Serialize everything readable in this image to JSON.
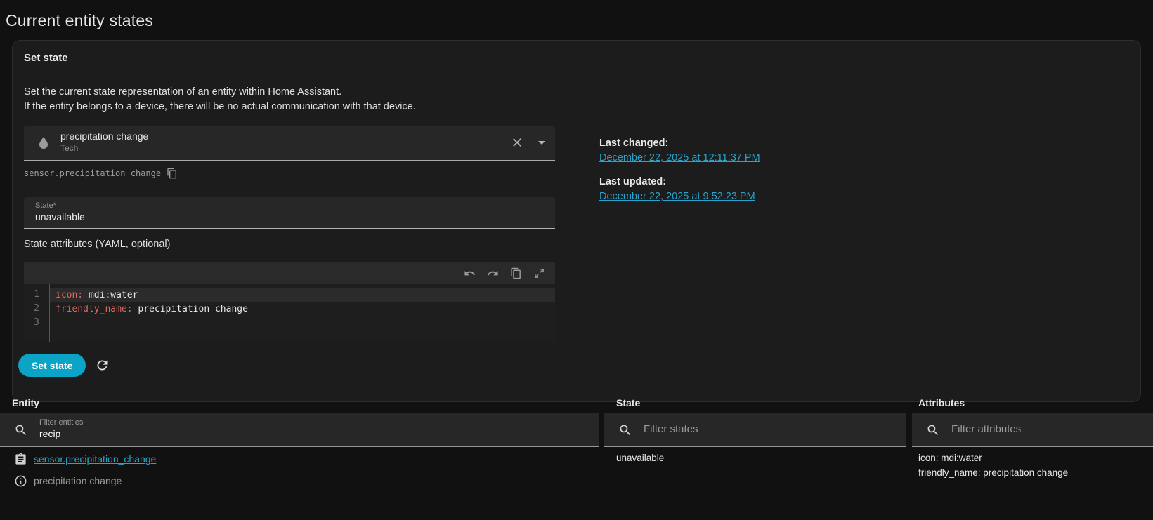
{
  "page": {
    "title": "Current entity states"
  },
  "card": {
    "title": "Set state",
    "description_line1": "Set the current state representation of an entity within Home Assistant.",
    "description_line2": "If the entity belongs to a device, there will be no actual communication with that device.",
    "entity_picker": {
      "name": "precipitation change",
      "area": "Tech"
    },
    "entity_id": "sensor.precipitation_change",
    "state_field": {
      "label": "State*",
      "value": "unavailable"
    },
    "attributes_label": "State attributes (YAML, optional)",
    "editor": {
      "lines": [
        {
          "number": "1",
          "key": "icon:",
          "value": " mdi:water"
        },
        {
          "number": "2",
          "key": "friendly_name:",
          "value": " precipitation change"
        },
        {
          "number": "3",
          "key": "",
          "value": ""
        }
      ]
    },
    "actions": {
      "set_state": "Set state"
    },
    "history": {
      "last_changed_label": "Last changed:",
      "last_changed": "December 22, 2025 at 12:11:37 PM",
      "last_updated_label": "Last updated:",
      "last_updated": "December 22, 2025 at 9:52:23 PM"
    }
  },
  "table": {
    "headers": {
      "entity": "Entity",
      "state": "State",
      "attributes": "Attributes"
    },
    "filters": {
      "entity_label": "Filter entities",
      "entity_value": "recip",
      "state_placeholder": "Filter states",
      "attributes_placeholder": "Filter attributes"
    },
    "row": {
      "entity_id": "sensor.precipitation_change",
      "friendly_name": "precipitation change",
      "state": "unavailable",
      "attr_line1": "icon: mdi:water",
      "attr_line2": "friendly_name: precipitation change"
    }
  },
  "colors": {
    "accent": "#0ba4c7",
    "link": "#29a3cb",
    "yaml_key": "#e0695f"
  }
}
